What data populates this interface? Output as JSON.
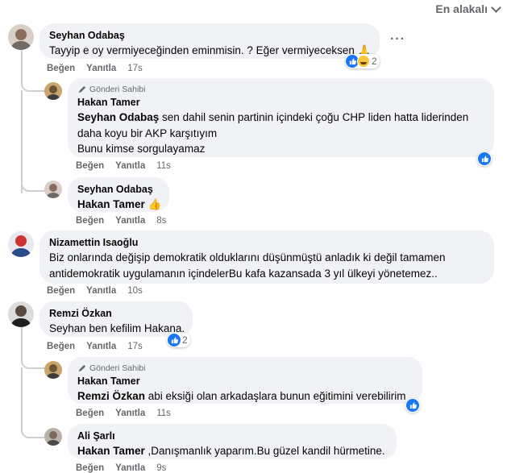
{
  "sort": {
    "label": "En alakalı"
  },
  "labels": {
    "like": "Beğen",
    "reply": "Yanıtla",
    "author_badge": "Gönderi Sahibi"
  },
  "colors": {
    "like_blue": "#1877f2",
    "bubble": "#f0f2f5",
    "meta": "#65676b"
  },
  "comments": [
    {
      "author": "Seyhan Odabaş",
      "text": "Tayyip e oy vermiyeceğinden eminmisin. ? Eğer vermiyeceksen 🙏",
      "time": "17s",
      "reactions": {
        "icons": [
          "like-icon",
          "haha-icon"
        ],
        "count": "2"
      }
    },
    {
      "author": "Hakan Tamer",
      "badge": true,
      "mention": "Seyhan Odabaş",
      "text_1": " sen dahil senin partinin içindeki çoğu CHP liden hatta liderinden",
      "text_2": "daha koyu bir AKP karşıtıyım",
      "text_3": "Bunu kimse sorgulayamaz",
      "time": "11s",
      "reactions": {
        "icons": [
          "like-icon"
        ]
      }
    },
    {
      "author": "Seyhan Odabaş",
      "mention": "Hakan Tamer",
      "text": " 👍",
      "time": "8s"
    },
    {
      "author": "Nizamettin Isaoğlu",
      "text_1": "Biz onlarında değişip demokratik olduklarını düşünmüştü anladık ki değil tamamen",
      "text_2": "antidemokratik uygulamanın içindelerBu kafa kazansada 3 yıl ülkeyi yönetemez..",
      "time": "10s"
    },
    {
      "author": "Remzi Özkan",
      "text": "Seyhan ben kefilim Hakana.",
      "time": "17s",
      "reactions": {
        "icons": [
          "like-icon"
        ],
        "count": "2"
      }
    },
    {
      "author": "Hakan Tamer",
      "badge": true,
      "mention": "Remzi Özkan",
      "text": " abi eksiği olan arkadaşlara bunun eğitimini verebilirim",
      "time": "11s",
      "reactions": {
        "icons": [
          "like-icon"
        ]
      }
    },
    {
      "author": "Ali Şarlı",
      "mention": "Hakan Tamer",
      "text": " ,Danışmanlık yaparım.Bu güzel kandil hürmetine.",
      "time": "9s"
    }
  ]
}
